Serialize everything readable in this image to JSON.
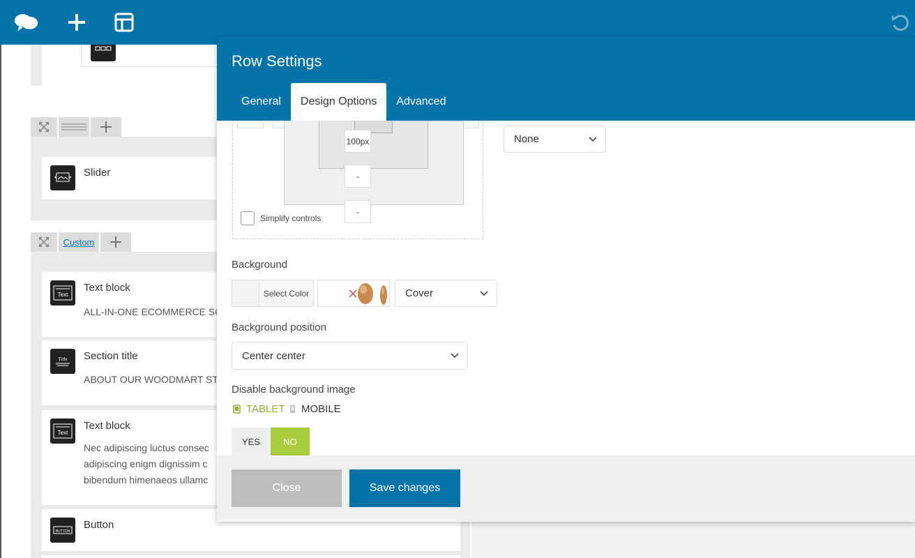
{
  "topbar": {
    "icons": [
      "logo-icon",
      "plus-icon",
      "layout-icon",
      "undo-icon"
    ]
  },
  "builder": {
    "rows": [
      {
        "custom_label": ""
      },
      {
        "custom_label": "Custom"
      }
    ],
    "elements": [
      {
        "title": "Slider",
        "icon": "slider-icon"
      },
      {
        "title": "Text block",
        "text": "ALL-IN-ONE ECOMMERCE SO",
        "icon_label": "Text"
      },
      {
        "title": "Section title",
        "text": "ABOUT OUR WOODMART ST",
        "icon_label": "Title"
      },
      {
        "title": "Text block",
        "lines": [
          "Nec  adipiscing luctus consec",
          "adipiscing enigm dignissim c",
          "bibendum himenaeos ullamc"
        ],
        "icon_label": "Text"
      },
      {
        "title": "Button",
        "icon_label": "BUTTON"
      }
    ]
  },
  "panel": {
    "title": "Row Settings",
    "tabs": [
      {
        "label": "General",
        "active": false
      },
      {
        "label": "Design Options",
        "active": true
      },
      {
        "label": "Advanced",
        "active": false
      }
    ],
    "box": {
      "padding_value": "100px",
      "dash1": "-",
      "dash2": "-",
      "simplify_label": "Simplify controls"
    },
    "border_style": "None",
    "background": {
      "label": "Background",
      "select_color": "Select Color",
      "size": "Cover"
    },
    "background_position": {
      "label": "Background position",
      "value": "Center center"
    },
    "disable_bg": {
      "label": "Disable background image",
      "tablet": "TABLET",
      "mobile": "MOBILE",
      "yes": "YES",
      "no": "NO"
    },
    "footer": {
      "close": "Close",
      "save": "Save changes"
    }
  },
  "colors": {
    "brand": "#0473aa",
    "green": "#a9cc3d"
  }
}
